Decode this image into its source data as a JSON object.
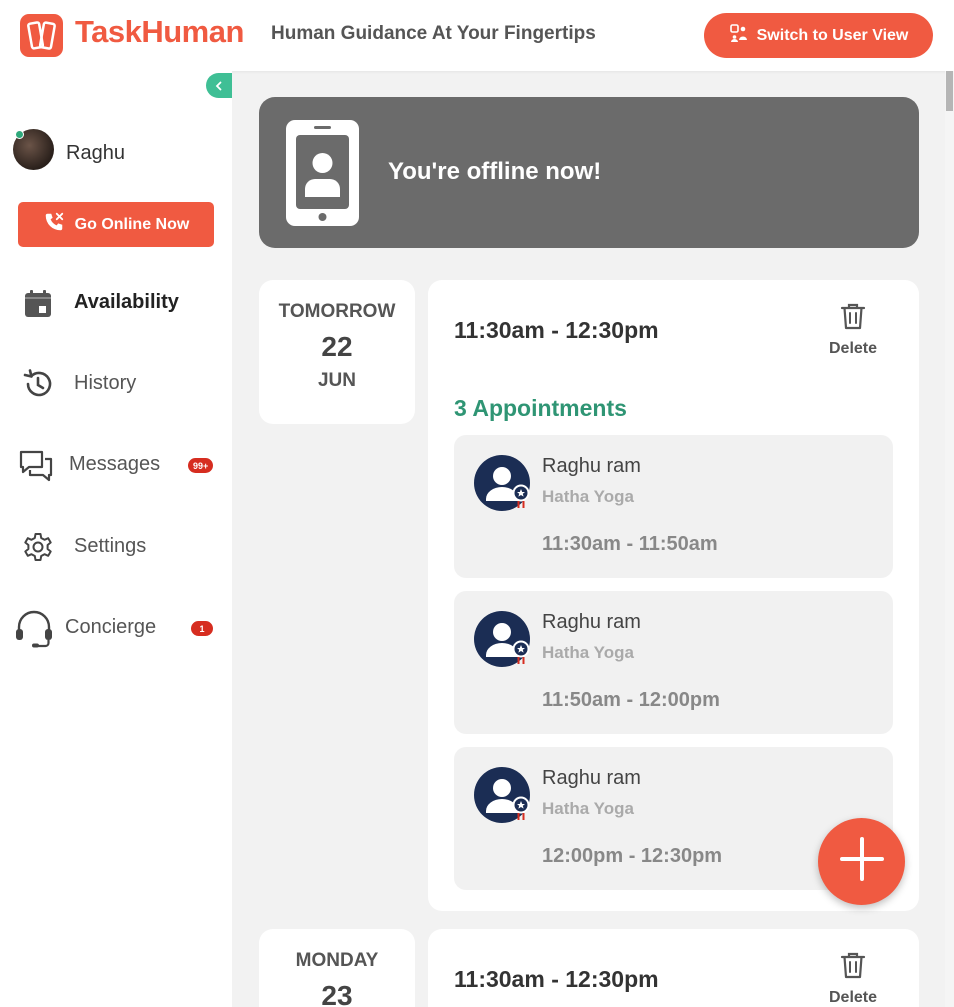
{
  "header": {
    "brand": "TaskHuman",
    "tagline": "Human Guidance At Your Fingertips",
    "switch_label": "Switch to User View"
  },
  "sidebar": {
    "user_name": "Raghu",
    "go_online_label": "Go Online Now",
    "items": [
      {
        "label": "Availability",
        "active": true,
        "badge": ""
      },
      {
        "label": "History",
        "active": false,
        "badge": ""
      },
      {
        "label": "Messages",
        "active": false,
        "badge": "99+"
      },
      {
        "label": "Settings",
        "active": false,
        "badge": ""
      },
      {
        "label": "Concierge",
        "active": false,
        "badge": "1"
      }
    ]
  },
  "banner": {
    "text": "You're offline now!"
  },
  "days": [
    {
      "day": "TOMORROW",
      "date": "22",
      "month": "JUN",
      "slot_time": "11:30am - 12:30pm",
      "delete_label": "Delete",
      "appointments_label": "3 Appointments",
      "appointments": [
        {
          "name": "Raghu ram",
          "service": "Hatha Yoga",
          "time": "11:30am - 11:50am"
        },
        {
          "name": "Raghu ram",
          "service": "Hatha Yoga",
          "time": "11:50am - 12:00pm"
        },
        {
          "name": "Raghu ram",
          "service": "Hatha Yoga",
          "time": "12:00pm - 12:30pm"
        }
      ]
    },
    {
      "day": "MONDAY",
      "date": "23",
      "month": "",
      "slot_time": "11:30am - 12:30pm",
      "delete_label": "Delete"
    }
  ],
  "colors": {
    "brand": "#f05a41",
    "accent_green": "#2f9574",
    "banner_gray": "#6b6b6b",
    "badge_red": "#d62d20"
  },
  "icons": {
    "logo": "taskhuman-logo-icon",
    "switch": "switch-view-icon",
    "collapse": "chevron-left-icon",
    "go_online": "phone-off-icon",
    "availability": "calendar-icon",
    "history": "history-icon",
    "messages": "chat-icon",
    "settings": "gear-icon",
    "concierge": "headset-icon",
    "delete": "trash-icon",
    "add": "plus-icon"
  }
}
